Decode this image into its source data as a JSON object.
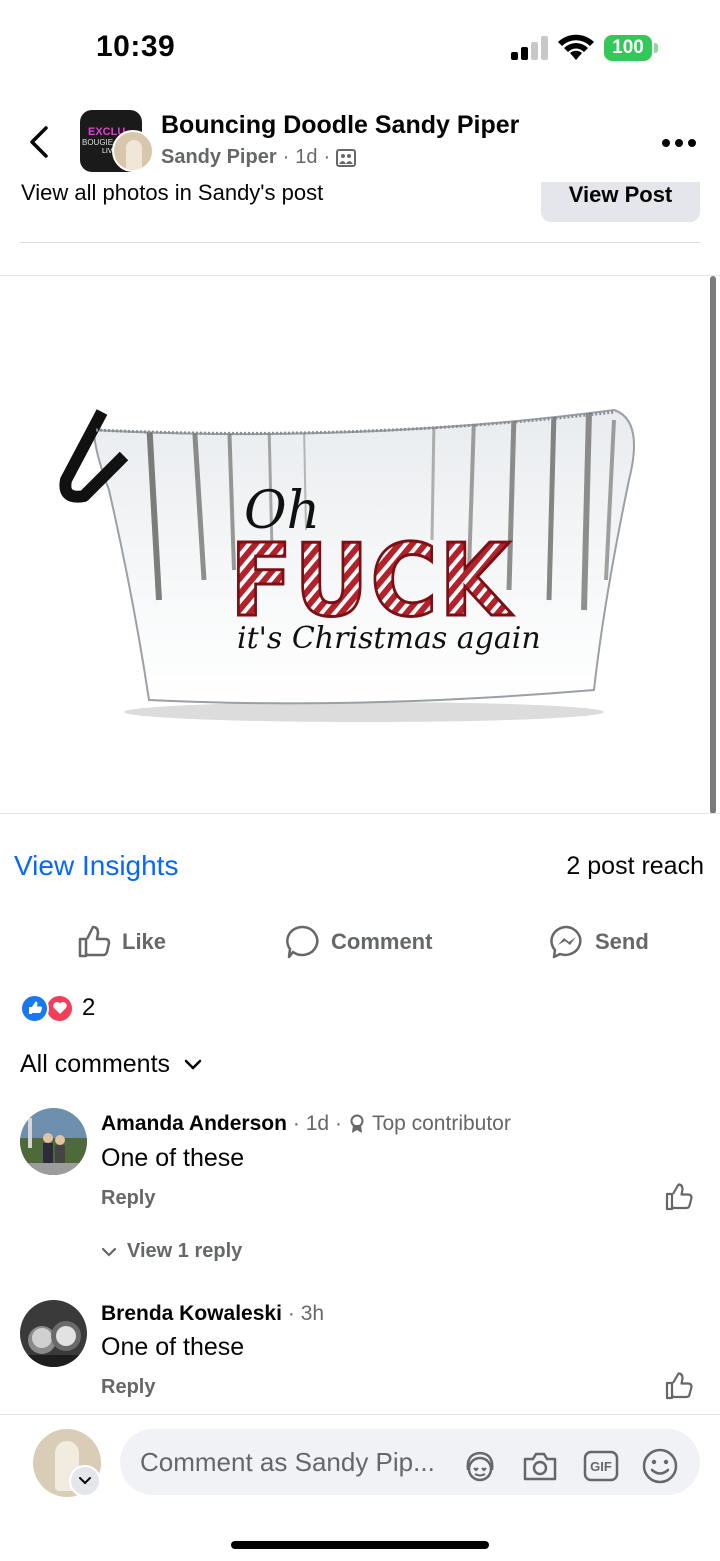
{
  "status_bar": {
    "time": "10:39",
    "battery": "100"
  },
  "header": {
    "title": "Bouncing Doodle Sandy Piper",
    "author": "Sandy Piper",
    "sep": "·",
    "age": "1d",
    "sep2": "·",
    "group_avatar_text": {
      "line1": "EXCLU",
      "line2": "BOUGIE-OR",
      "line3": "LIVE"
    }
  },
  "photo_row": {
    "text": "View all photos in Sandy's post",
    "button": "View Post"
  },
  "product_image": {
    "line1": "Oh",
    "line2": "FUCK",
    "line3": "it's Christmas again"
  },
  "insights": {
    "link": "View Insights",
    "reach": "2 post reach"
  },
  "actions": {
    "like": "Like",
    "comment": "Comment",
    "send": "Send"
  },
  "reactions": {
    "count": "2"
  },
  "comments_filter": {
    "label": "All comments"
  },
  "comments": [
    {
      "name": "Amanda Anderson",
      "meta": "· 1d ·",
      "badge": "Top contributor",
      "text": "One of these",
      "reply": "Reply",
      "view_replies": "View 1 reply"
    },
    {
      "name": "Brenda Kowaleski",
      "meta": "· 3h",
      "text": "One of these",
      "reply": "Reply"
    }
  ],
  "composer": {
    "placeholder": "Comment as Sandy Pip..."
  },
  "colors": {
    "link_blue": "#0866ff",
    "like_blue": "#1877f2",
    "love_red": "#f33e58",
    "battery_green": "#34c759",
    "text_gray": "#65676b"
  }
}
